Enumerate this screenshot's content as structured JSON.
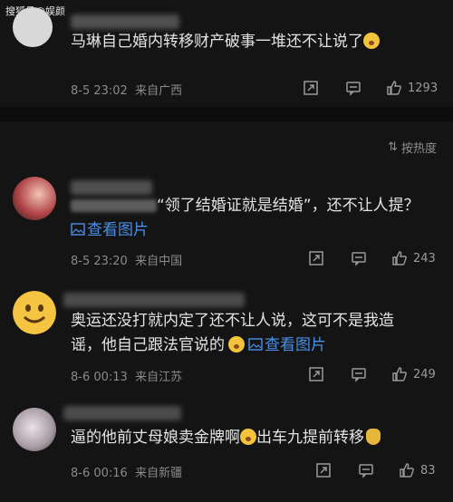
{
  "watermark": "搜狐号@娱颜",
  "sort": {
    "label": "按热度"
  },
  "comments": [
    {
      "text": "马琳自己婚内转移财产破事一堆还不让说了",
      "time": "8-5 23:02",
      "location": "来自广西",
      "likes": "1293"
    },
    {
      "text_prefix": "",
      "text_main": "“领了结婚证就是结婚”，还不让人提？",
      "link": "查看图片",
      "time": "8-5 23:20",
      "location": "来自中国",
      "likes": "243"
    },
    {
      "text_line1": "奥运还没打就内定了还不让人说，这可不是我造",
      "text_line2": "谣，他自己跟法官说的",
      "link": "查看图片",
      "time": "8-6 00:13",
      "location": "来自江苏",
      "likes": "249"
    },
    {
      "text_a": "逼的他前丈母娘卖金牌啊",
      "text_b": "出车九提前转移",
      "time": "8-6 00:16",
      "location": "来自新疆",
      "likes": "83"
    }
  ]
}
